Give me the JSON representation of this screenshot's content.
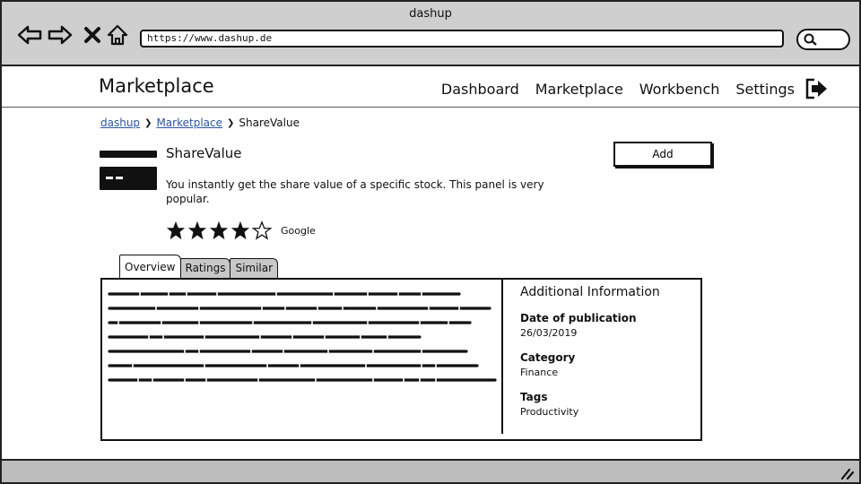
{
  "window": {
    "title": "dashup"
  },
  "browser": {
    "url": "https://www.dashup.de",
    "icons": [
      "back-arrow-icon",
      "forward-arrow-icon",
      "close-x-icon",
      "home-icon",
      "search-icon"
    ]
  },
  "header": {
    "brand": "Marketplace",
    "nav": [
      {
        "label": "Dashboard"
      },
      {
        "label": "Marketplace"
      },
      {
        "label": "Workbench"
      },
      {
        "label": "Settings"
      }
    ],
    "logout_icon": "logout-icon"
  },
  "breadcrumb": {
    "items": [
      {
        "label": "dashup",
        "link": true
      },
      {
        "label": "Marketplace",
        "link": true
      },
      {
        "label": "ShareValue",
        "link": false
      }
    ]
  },
  "item": {
    "title": "ShareValue",
    "description": "You instantly get the share value of a specific stock. This panel is very popular.",
    "add_label": "Add",
    "rating": {
      "value": 4,
      "max": 5,
      "source": "Google"
    }
  },
  "tabs": [
    {
      "label": "Overview",
      "active": true
    },
    {
      "label": "Ratings",
      "active": false
    },
    {
      "label": "Similar",
      "active": false
    }
  ],
  "info": {
    "heading": "Additional Information",
    "fields": [
      {
        "label": "Date of publication",
        "value": "26/03/2019"
      },
      {
        "label": "Category",
        "value": "Finance"
      },
      {
        "label": "Tags",
        "value": "Productivity"
      }
    ]
  },
  "colors": {
    "chrome": "#cfcfcf",
    "link": "#2a55a3",
    "ink": "#111111"
  }
}
